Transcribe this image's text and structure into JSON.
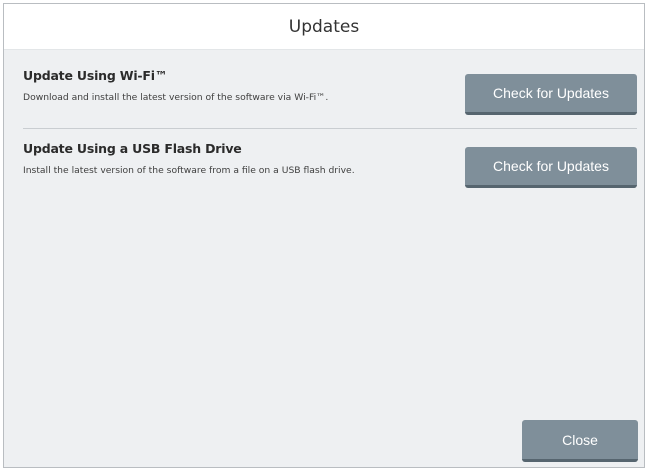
{
  "dialog": {
    "title": "Updates"
  },
  "sections": [
    {
      "title": "Update Using Wi-Fi™",
      "description": "Download and install the latest version of the software via Wi-Fi™.",
      "button_label": "Check for Updates"
    },
    {
      "title": "Update Using a USB Flash Drive",
      "description": "Install the latest version of the software from a file on a USB flash drive.",
      "button_label": "Check for Updates"
    }
  ],
  "footer": {
    "close_label": "Close"
  },
  "colors": {
    "button_bg": "#7f8f9a",
    "button_shadow": "#56656f",
    "panel_bg": "#eef0f2",
    "titlebar_bg": "#ffffff"
  }
}
